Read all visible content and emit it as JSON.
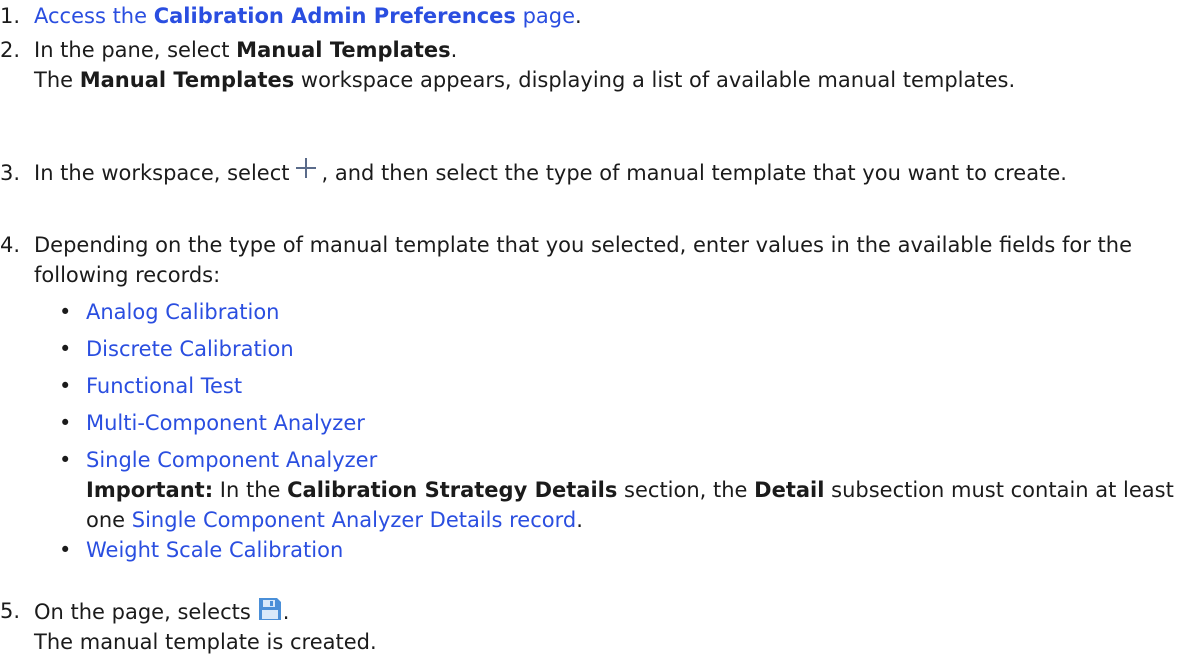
{
  "steps": [
    {
      "number": "1.",
      "link_text": "Access the ",
      "link_bold": "Calibration Admin Preferences",
      "link_after": " page",
      "after": "."
    },
    {
      "number": "2.",
      "line1_pre": "In the pane, select ",
      "line1_bold": "Manual Templates",
      "line1_post": ".",
      "result_pre": "The ",
      "result_bold": "Manual Templates",
      "result_post": " workspace appears, displaying a list of available manual templates."
    },
    {
      "number": "3.",
      "pre": "In the workspace, select",
      "icon": "plus-icon",
      "post": ", and then select the type of manual template that you want to create."
    },
    {
      "number": "4.",
      "text": "Depending on the type of manual template that you selected, enter values in the available fields for the following records:",
      "records": [
        "Analog Calibration",
        "Discrete Calibration",
        "Functional Test",
        "Multi-Component Analyzer",
        "Single Component Analyzer",
        "Weight Scale Calibration"
      ],
      "note": {
        "label": "Important:",
        "pre": " In the ",
        "bold1": "Calibration Strategy Details",
        "mid1": " section, the ",
        "bold2": "Detail",
        "mid2": " subsection must contain at least one ",
        "link": "Single Component Analyzer Details record",
        "post": "."
      }
    },
    {
      "number": "5.",
      "pre": "On the page, selects",
      "icon": "save-icon",
      "post": ".",
      "result": "The manual template is created."
    }
  ],
  "bullet": "•",
  "colors": {
    "text": "#1b1b1b",
    "link": "#2a4ee0",
    "save_icon": "#4a8fd8"
  }
}
